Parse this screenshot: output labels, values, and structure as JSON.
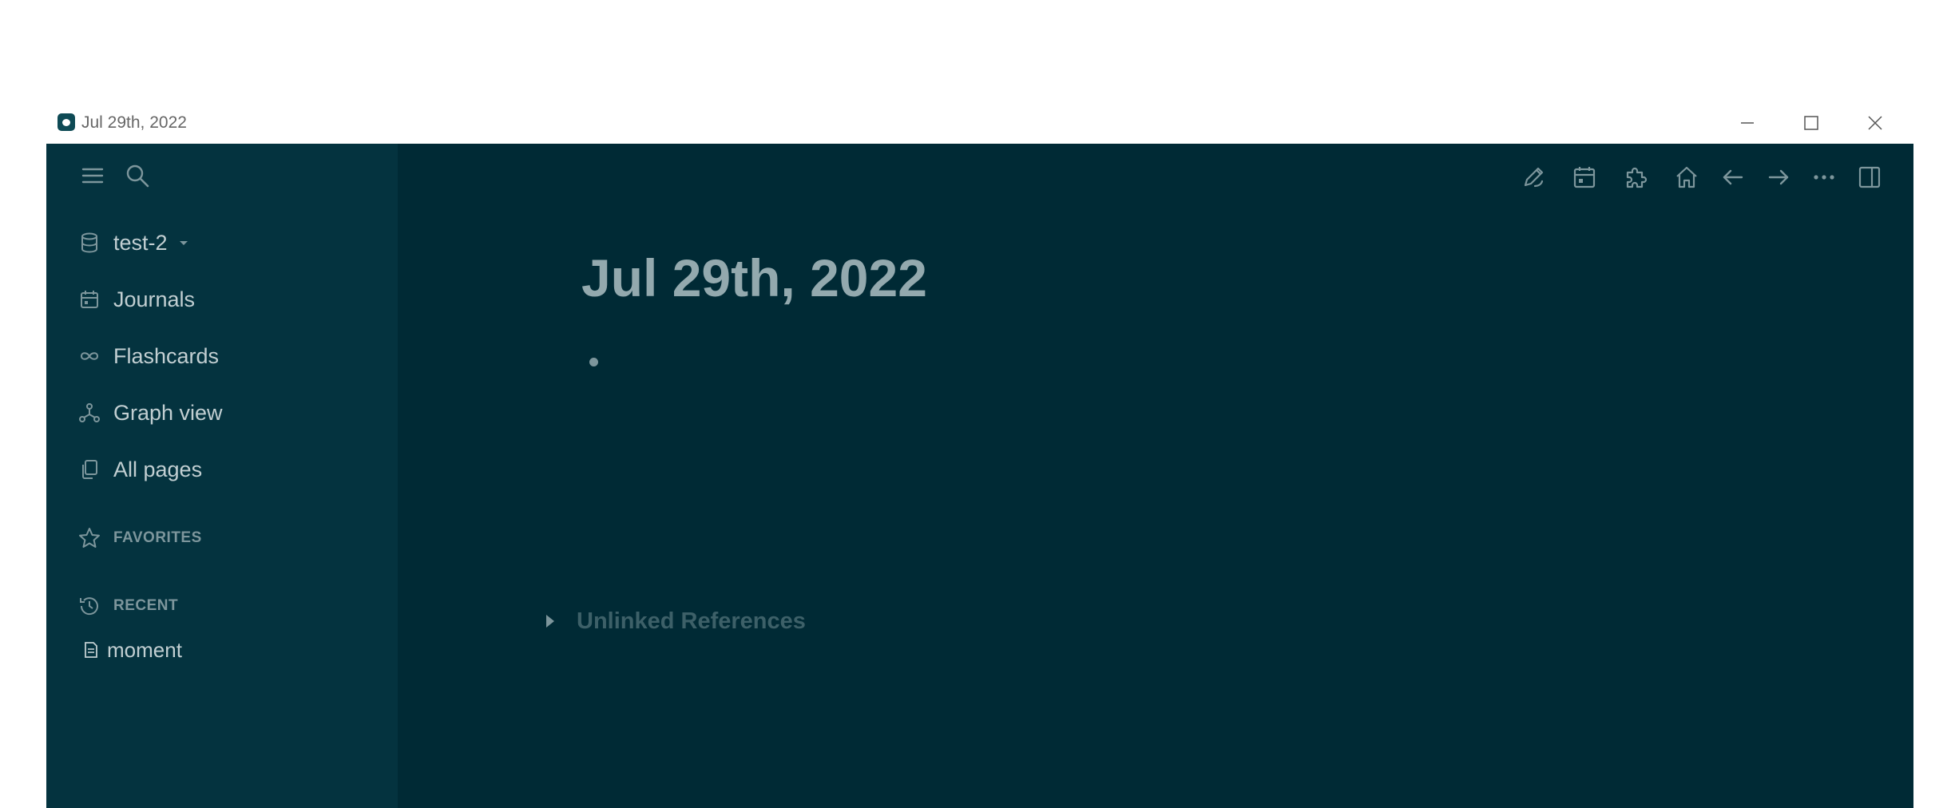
{
  "window": {
    "title": "Jul 29th, 2022",
    "icons": [
      "app-icon",
      "minimize-icon",
      "maximize-icon",
      "close-icon"
    ]
  },
  "sidebar": {
    "top_icons": [
      "menu-icon",
      "search-icon"
    ],
    "graph": {
      "label": "test-2",
      "icon": "database-icon"
    },
    "items": [
      {
        "label": "Journals",
        "icon": "calendar-icon"
      },
      {
        "label": "Flashcards",
        "icon": "infinity-icon"
      },
      {
        "label": "Graph view",
        "icon": "graph-icon"
      },
      {
        "label": "All pages",
        "icon": "pages-icon"
      }
    ],
    "favorites": {
      "label": "FAVORITES",
      "icon": "star-icon"
    },
    "recent": {
      "label": "RECENT",
      "icon": "history-icon",
      "items": [
        {
          "label": "moment",
          "icon": "file-icon"
        }
      ]
    }
  },
  "toolbar": {
    "icons": [
      "pencil-icon",
      "calendar-icon",
      "puzzle-icon",
      "home-icon",
      "arrow-left-icon",
      "arrow-right-icon",
      "more-icon",
      "right-sidebar-icon"
    ]
  },
  "page": {
    "title": "Jul 29th, 2022",
    "unlinked_references": "Unlinked References"
  },
  "colors": {
    "main_bg": "#002a35",
    "sidebar_bg": "#04333f",
    "text": "#c2cfd2",
    "muted": "#7d969c"
  }
}
